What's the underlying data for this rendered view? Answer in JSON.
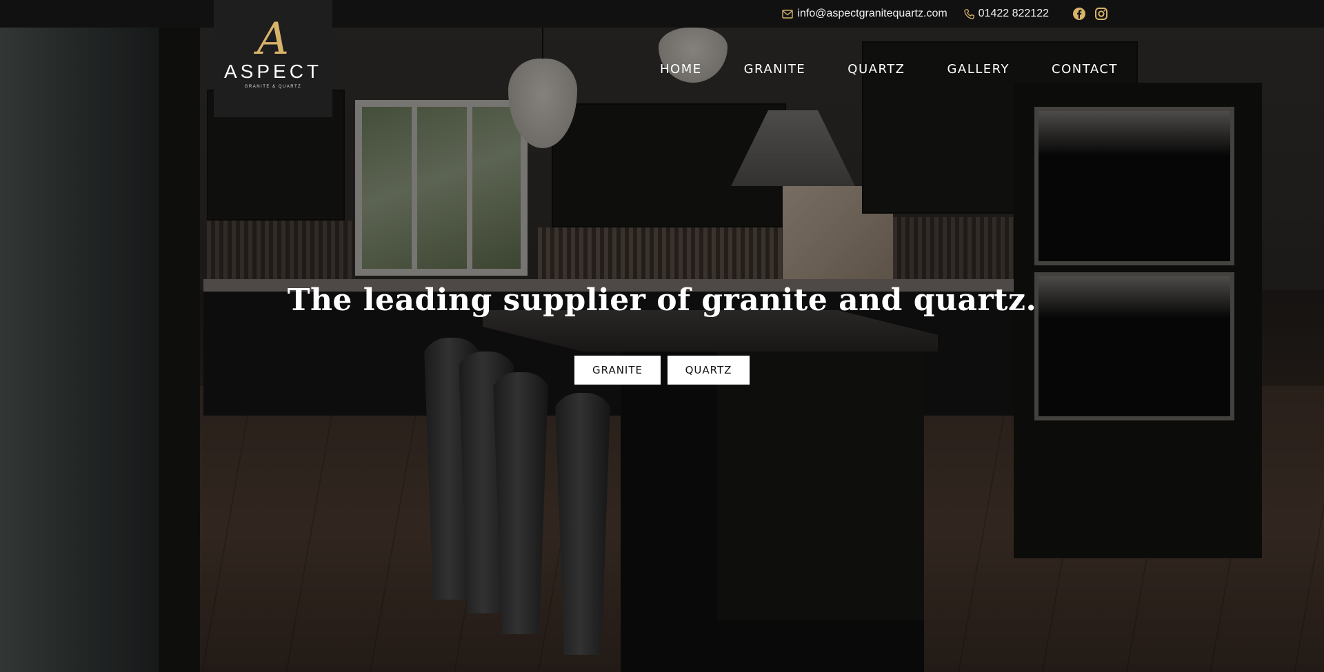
{
  "topbar": {
    "email": "info@aspectgranitequartz.com",
    "phone": "01422 822122",
    "email_icon": "envelope-icon",
    "phone_icon": "phone-icon",
    "socials": [
      "facebook-icon",
      "instagram-icon"
    ]
  },
  "logo": {
    "mark": "A",
    "name": "ASPECT",
    "tagline": "GRANITE & QUARTZ"
  },
  "nav": {
    "items": [
      "HOME",
      "GRANITE",
      "QUARTZ",
      "GALLERY",
      "CONTACT"
    ]
  },
  "hero": {
    "headline": "The leading supplier of granite and quartz.",
    "buttons": [
      "GRANITE",
      "QUARTZ"
    ]
  },
  "colors": {
    "accent_gold": "#d8b36a",
    "topbar_bg": "#111111",
    "logo_bg": "#1e1e1e",
    "button_bg": "#ffffff"
  }
}
